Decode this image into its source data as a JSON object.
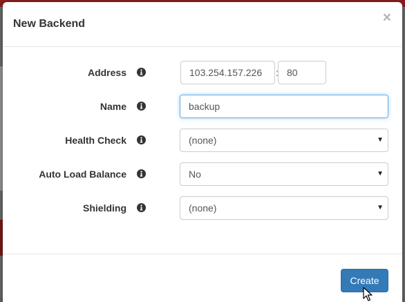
{
  "modal": {
    "title": "New Backend",
    "close_label": "×"
  },
  "form": {
    "address": {
      "label": "Address",
      "host": "103.254.157.226",
      "separator": ":",
      "port": "80"
    },
    "name": {
      "label": "Name",
      "value": "backup"
    },
    "health_check": {
      "label": "Health Check",
      "selected": "(none)"
    },
    "auto_load_balance": {
      "label": "Auto Load Balance",
      "selected": "No"
    },
    "shielding": {
      "label": "Shielding",
      "selected": "(none)"
    }
  },
  "footer": {
    "create_label": "Create"
  },
  "icons": {
    "info": "info-icon",
    "close": "close-icon",
    "caret": "caret-down-icon",
    "cursor": "mouse-pointer-icon"
  },
  "colors": {
    "primary": "#337ab7",
    "focus": "#66afe9",
    "text": "#333333"
  }
}
